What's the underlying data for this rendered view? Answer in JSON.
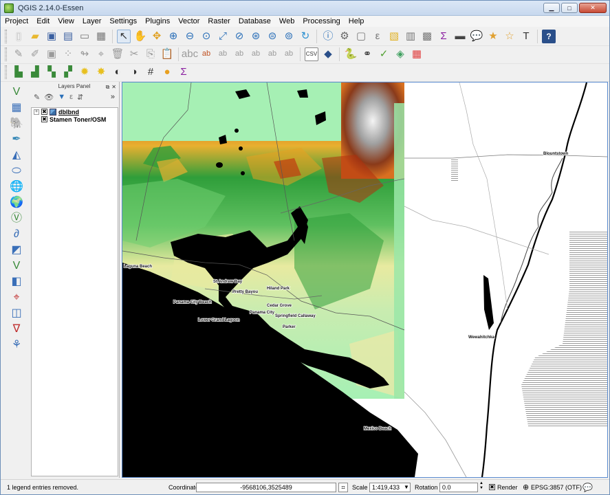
{
  "window": {
    "title": "QGIS 2.14.0-Essen",
    "minimize": "▁",
    "maximize": "□",
    "close": "✕"
  },
  "menubar": {
    "items": [
      "Project",
      "Edit",
      "View",
      "Layer",
      "Settings",
      "Plugins",
      "Vector",
      "Raster",
      "Database",
      "Web",
      "Processing",
      "Help"
    ]
  },
  "layers_panel": {
    "title": "Layers Panel",
    "layers": [
      {
        "name": "dblbnd",
        "checked": "✖",
        "expander": "+"
      },
      {
        "name": "Stamen Toner/OSM",
        "checked": "✖",
        "expander": ""
      }
    ]
  },
  "map": {
    "place_labels": [
      "Blountstown",
      "Laguna Beach",
      "St Andrew Bay",
      "Pretty Bayou",
      "Hiland Park",
      "Panama City Beach",
      "Cedar Grove",
      "Panama City",
      "Springfield",
      "Callaway",
      "Lower Grand Lagoon",
      "Parker",
      "Wewahitchka",
      "Mexico Beach"
    ]
  },
  "statusbar": {
    "message": "1 legend entries removed.",
    "coordinate_label": "Coordinate",
    "coordinate_value": "-9568106,3525489",
    "scale_label": "Scale",
    "scale_value": "1:419,433",
    "rotation_label": "Rotation",
    "rotation_value": "0.0",
    "render_label": "Render",
    "render_checked": "✖",
    "crs_label": "EPSG:3857 (OTF)"
  },
  "colors": {
    "accent": "#3399ff",
    "dem_low": "#a6f0b4",
    "dem_mid": "#2f9e3a",
    "dem_high": "#e8a020",
    "dem_peak": "#b0200a",
    "water": "#000000"
  }
}
